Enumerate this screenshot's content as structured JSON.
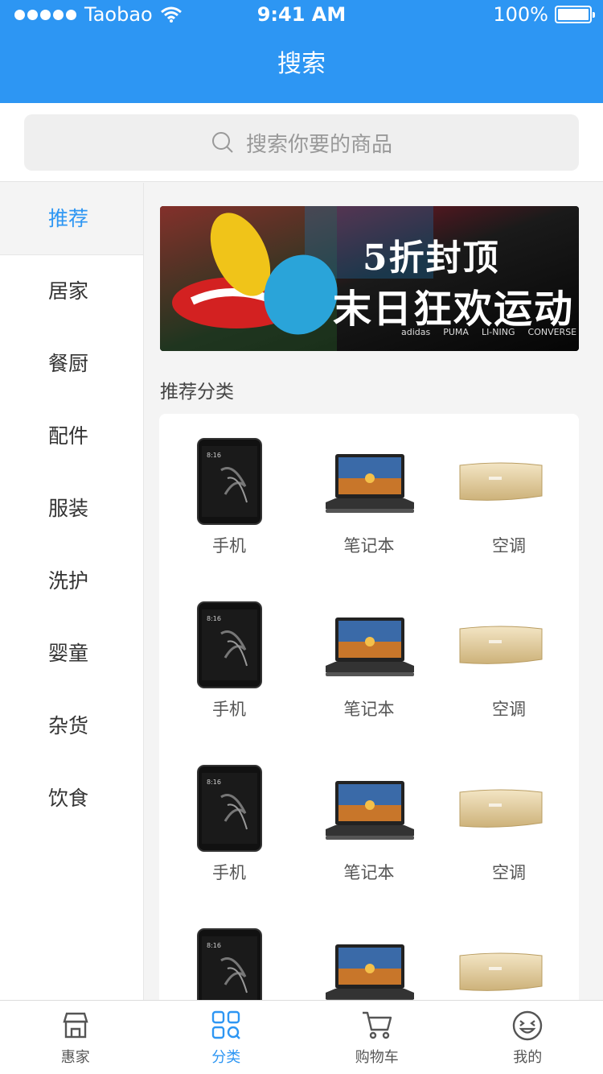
{
  "status_bar": {
    "carrier": "Taobao",
    "time": "9:41 AM",
    "battery": "100%"
  },
  "header": {
    "title": "搜索"
  },
  "search": {
    "placeholder": "搜索你要的商品"
  },
  "sidebar": {
    "items": [
      {
        "label": "推荐",
        "active": true
      },
      {
        "label": "居家"
      },
      {
        "label": "餐厨"
      },
      {
        "label": "配件"
      },
      {
        "label": "服装"
      },
      {
        "label": "洗护"
      },
      {
        "label": "婴童"
      },
      {
        "label": "杂货"
      },
      {
        "label": "饮食"
      }
    ]
  },
  "banner": {
    "text_line1": "5折封顶",
    "text_line2": "末日狂欢运动",
    "brands": [
      "adidas",
      "PUMA",
      "LI-NING",
      "CONVERSE"
    ]
  },
  "recommend": {
    "section_title": "推荐分类",
    "rows": [
      [
        "手机",
        "笔记本",
        "空调"
      ],
      [
        "手机",
        "笔记本",
        "空调"
      ],
      [
        "手机",
        "笔记本",
        "空调"
      ],
      [
        "",
        "",
        ""
      ]
    ]
  },
  "tabbar": {
    "tabs": [
      {
        "label": "惠家",
        "icon": "shop-icon"
      },
      {
        "label": "分类",
        "icon": "grid-search-icon",
        "active": true
      },
      {
        "label": "购物车",
        "icon": "cart-icon"
      },
      {
        "label": "我的",
        "icon": "face-icon"
      }
    ]
  },
  "colors": {
    "accent": "#2d96f3",
    "background": "#f4f4f4"
  }
}
